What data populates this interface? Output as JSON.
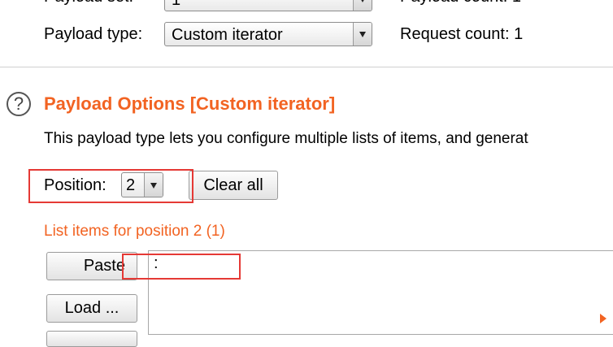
{
  "payload_set": {
    "label": "Payload set:",
    "value": "1"
  },
  "payload_count": {
    "label": "Payload count: 1"
  },
  "payload_type": {
    "label": "Payload type:",
    "value": "Custom iterator"
  },
  "request_count": {
    "label": "Request count: 1"
  },
  "section": {
    "help_glyph": "?",
    "title": "Payload Options [Custom iterator]",
    "description": "This payload type lets you configure multiple lists of items, and generat"
  },
  "position": {
    "label": "Position:",
    "value": "2",
    "clear_all": "Clear all"
  },
  "list": {
    "heading": "List items for position 2 (1)",
    "items": [
      ":"
    ],
    "buttons": {
      "paste": "Paste",
      "load": "Load ..."
    }
  },
  "colors": {
    "accent": "#f26322",
    "highlight": "#e53935"
  }
}
